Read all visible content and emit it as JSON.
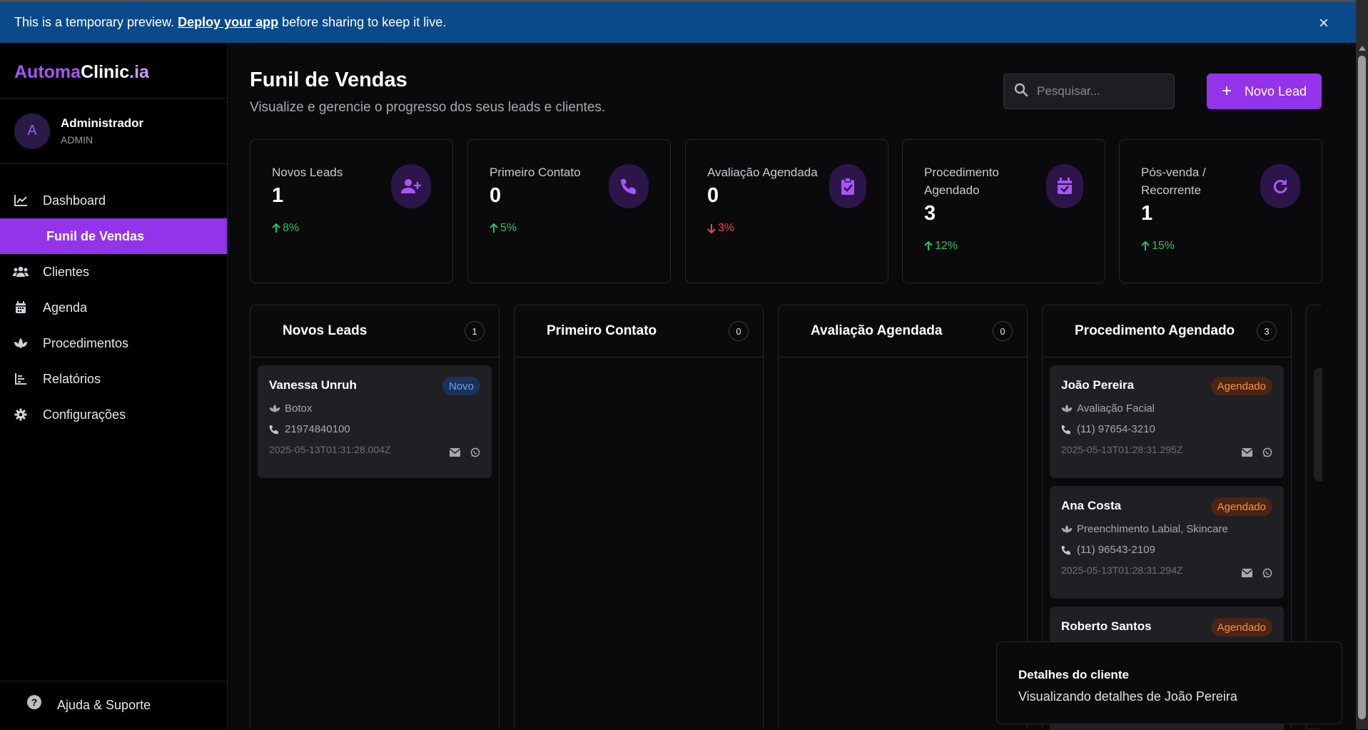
{
  "banner": {
    "text_before": "This is a temporary preview.",
    "link": "Deploy your app",
    "text_after": "before sharing to keep it live.",
    "close": "×"
  },
  "brand": {
    "part1": "Automa",
    "part2": "Clinic",
    "part3": ".ia"
  },
  "user": {
    "initial": "A",
    "name": "Administrador",
    "role": "ADMIN"
  },
  "nav": {
    "items": [
      {
        "label": "Dashboard",
        "icon": "chart-line-icon"
      },
      {
        "label": "Funil de Vendas",
        "icon": "funnel-icon",
        "active": true
      },
      {
        "label": "Clientes",
        "icon": "users-icon"
      },
      {
        "label": "Agenda",
        "icon": "calendar-icon"
      },
      {
        "label": "Procedimentos",
        "icon": "lotus-icon"
      },
      {
        "label": "Relatórios",
        "icon": "bar-chart-icon"
      },
      {
        "label": "Configurações",
        "icon": "gear-icon"
      }
    ],
    "help": "Ajuda & Suporte",
    "help_icon": "?"
  },
  "header": {
    "title": "Funil de Vendas",
    "subtitle": "Visualize e gerencie o progresso dos seus leads e clientes.",
    "search_placeholder": "Pesquisar...",
    "new_lead": "Novo Lead",
    "new_lead_icon": "+"
  },
  "stats": [
    {
      "label": "Novos Leads",
      "value": "1",
      "trend": "8%",
      "direction": "up",
      "icon": "user-plus-icon"
    },
    {
      "label": "Primeiro Contato",
      "value": "0",
      "trend": "5%",
      "direction": "up",
      "icon": "phone-icon"
    },
    {
      "label": "Avaliação Agendada",
      "value": "0",
      "trend": "3%",
      "direction": "down",
      "icon": "clipboard-check-icon"
    },
    {
      "label": "Procedimento Agendado",
      "value": "3",
      "trend": "12%",
      "direction": "up",
      "icon": "calendar-check-icon"
    },
    {
      "label": "Pós-venda / Recorrente",
      "value": "1",
      "trend": "15%",
      "direction": "up",
      "icon": "refresh-icon"
    }
  ],
  "columns": [
    {
      "title": "Novos Leads",
      "count": "1",
      "cards": [
        {
          "name": "Vanessa Unruh",
          "tag": "Novo",
          "procedure": "Botox",
          "phone": "21974840100",
          "timestamp": "2025-05-13T01:31:28.004Z"
        }
      ]
    },
    {
      "title": "Primeiro Contato",
      "count": "0",
      "cards": []
    },
    {
      "title": "Avaliação Agendada",
      "count": "0",
      "cards": []
    },
    {
      "title": "Procedimento Agendado",
      "count": "3",
      "cards": [
        {
          "name": "João Pereira",
          "tag": "Agendado",
          "procedure": "Avaliação Facial",
          "phone": "(11) 97654-3210",
          "timestamp": "2025-05-13T01:28:31.295Z"
        },
        {
          "name": "Ana Costa",
          "tag": "Agendado",
          "procedure": "Preenchimento Labial, Skincare",
          "phone": "(11) 96543-2109",
          "timestamp": "2025-05-13T01:28:31.294Z"
        },
        {
          "name": "Roberto Santos",
          "tag": "Agendado"
        }
      ]
    }
  ],
  "toast": {
    "title": "Detalhes do cliente",
    "message": "Visualizando detalhes de João Pereira"
  },
  "colors": {
    "accent": "#9333ea",
    "brand_accent": "#a855f7",
    "trend_up": "#22c55e",
    "trend_down": "#ef4444",
    "tag_novo": "#60a5fa",
    "tag_agendado": "#fb923c",
    "banner": "#0b4a8a"
  }
}
